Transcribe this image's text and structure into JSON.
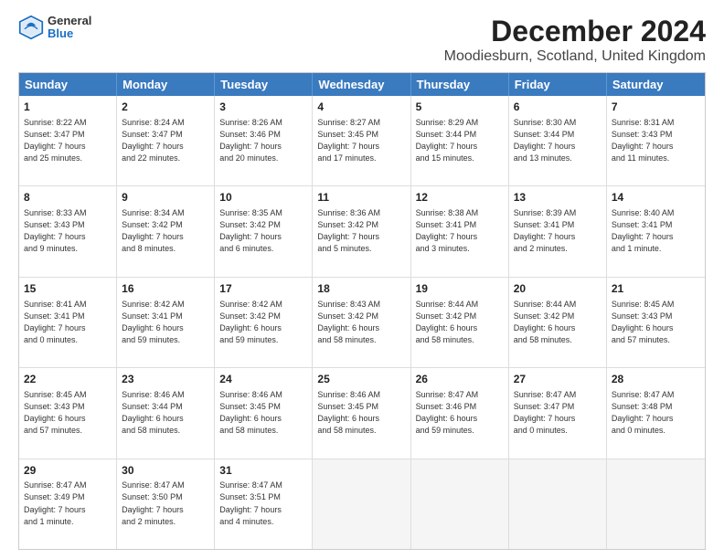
{
  "header": {
    "title": "December 2024",
    "subtitle": "Moodiesburn, Scotland, United Kingdom",
    "logo_general": "General",
    "logo_blue": "Blue"
  },
  "days": [
    "Sunday",
    "Monday",
    "Tuesday",
    "Wednesday",
    "Thursday",
    "Friday",
    "Saturday"
  ],
  "weeks": [
    [
      {
        "day": "1",
        "lines": [
          "Sunrise: 8:22 AM",
          "Sunset: 3:47 PM",
          "Daylight: 7 hours",
          "and 25 minutes."
        ]
      },
      {
        "day": "2",
        "lines": [
          "Sunrise: 8:24 AM",
          "Sunset: 3:47 PM",
          "Daylight: 7 hours",
          "and 22 minutes."
        ]
      },
      {
        "day": "3",
        "lines": [
          "Sunrise: 8:26 AM",
          "Sunset: 3:46 PM",
          "Daylight: 7 hours",
          "and 20 minutes."
        ]
      },
      {
        "day": "4",
        "lines": [
          "Sunrise: 8:27 AM",
          "Sunset: 3:45 PM",
          "Daylight: 7 hours",
          "and 17 minutes."
        ]
      },
      {
        "day": "5",
        "lines": [
          "Sunrise: 8:29 AM",
          "Sunset: 3:44 PM",
          "Daylight: 7 hours",
          "and 15 minutes."
        ]
      },
      {
        "day": "6",
        "lines": [
          "Sunrise: 8:30 AM",
          "Sunset: 3:44 PM",
          "Daylight: 7 hours",
          "and 13 minutes."
        ]
      },
      {
        "day": "7",
        "lines": [
          "Sunrise: 8:31 AM",
          "Sunset: 3:43 PM",
          "Daylight: 7 hours",
          "and 11 minutes."
        ]
      }
    ],
    [
      {
        "day": "8",
        "lines": [
          "Sunrise: 8:33 AM",
          "Sunset: 3:43 PM",
          "Daylight: 7 hours",
          "and 9 minutes."
        ]
      },
      {
        "day": "9",
        "lines": [
          "Sunrise: 8:34 AM",
          "Sunset: 3:42 PM",
          "Daylight: 7 hours",
          "and 8 minutes."
        ]
      },
      {
        "day": "10",
        "lines": [
          "Sunrise: 8:35 AM",
          "Sunset: 3:42 PM",
          "Daylight: 7 hours",
          "and 6 minutes."
        ]
      },
      {
        "day": "11",
        "lines": [
          "Sunrise: 8:36 AM",
          "Sunset: 3:42 PM",
          "Daylight: 7 hours",
          "and 5 minutes."
        ]
      },
      {
        "day": "12",
        "lines": [
          "Sunrise: 8:38 AM",
          "Sunset: 3:41 PM",
          "Daylight: 7 hours",
          "and 3 minutes."
        ]
      },
      {
        "day": "13",
        "lines": [
          "Sunrise: 8:39 AM",
          "Sunset: 3:41 PM",
          "Daylight: 7 hours",
          "and 2 minutes."
        ]
      },
      {
        "day": "14",
        "lines": [
          "Sunrise: 8:40 AM",
          "Sunset: 3:41 PM",
          "Daylight: 7 hours",
          "and 1 minute."
        ]
      }
    ],
    [
      {
        "day": "15",
        "lines": [
          "Sunrise: 8:41 AM",
          "Sunset: 3:41 PM",
          "Daylight: 7 hours",
          "and 0 minutes."
        ]
      },
      {
        "day": "16",
        "lines": [
          "Sunrise: 8:42 AM",
          "Sunset: 3:41 PM",
          "Daylight: 6 hours",
          "and 59 minutes."
        ]
      },
      {
        "day": "17",
        "lines": [
          "Sunrise: 8:42 AM",
          "Sunset: 3:42 PM",
          "Daylight: 6 hours",
          "and 59 minutes."
        ]
      },
      {
        "day": "18",
        "lines": [
          "Sunrise: 8:43 AM",
          "Sunset: 3:42 PM",
          "Daylight: 6 hours",
          "and 58 minutes."
        ]
      },
      {
        "day": "19",
        "lines": [
          "Sunrise: 8:44 AM",
          "Sunset: 3:42 PM",
          "Daylight: 6 hours",
          "and 58 minutes."
        ]
      },
      {
        "day": "20",
        "lines": [
          "Sunrise: 8:44 AM",
          "Sunset: 3:42 PM",
          "Daylight: 6 hours",
          "and 58 minutes."
        ]
      },
      {
        "day": "21",
        "lines": [
          "Sunrise: 8:45 AM",
          "Sunset: 3:43 PM",
          "Daylight: 6 hours",
          "and 57 minutes."
        ]
      }
    ],
    [
      {
        "day": "22",
        "lines": [
          "Sunrise: 8:45 AM",
          "Sunset: 3:43 PM",
          "Daylight: 6 hours",
          "and 57 minutes."
        ]
      },
      {
        "day": "23",
        "lines": [
          "Sunrise: 8:46 AM",
          "Sunset: 3:44 PM",
          "Daylight: 6 hours",
          "and 58 minutes."
        ]
      },
      {
        "day": "24",
        "lines": [
          "Sunrise: 8:46 AM",
          "Sunset: 3:45 PM",
          "Daylight: 6 hours",
          "and 58 minutes."
        ]
      },
      {
        "day": "25",
        "lines": [
          "Sunrise: 8:46 AM",
          "Sunset: 3:45 PM",
          "Daylight: 6 hours",
          "and 58 minutes."
        ]
      },
      {
        "day": "26",
        "lines": [
          "Sunrise: 8:47 AM",
          "Sunset: 3:46 PM",
          "Daylight: 6 hours",
          "and 59 minutes."
        ]
      },
      {
        "day": "27",
        "lines": [
          "Sunrise: 8:47 AM",
          "Sunset: 3:47 PM",
          "Daylight: 7 hours",
          "and 0 minutes."
        ]
      },
      {
        "day": "28",
        "lines": [
          "Sunrise: 8:47 AM",
          "Sunset: 3:48 PM",
          "Daylight: 7 hours",
          "and 0 minutes."
        ]
      }
    ],
    [
      {
        "day": "29",
        "lines": [
          "Sunrise: 8:47 AM",
          "Sunset: 3:49 PM",
          "Daylight: 7 hours",
          "and 1 minute."
        ]
      },
      {
        "day": "30",
        "lines": [
          "Sunrise: 8:47 AM",
          "Sunset: 3:50 PM",
          "Daylight: 7 hours",
          "and 2 minutes."
        ]
      },
      {
        "day": "31",
        "lines": [
          "Sunrise: 8:47 AM",
          "Sunset: 3:51 PM",
          "Daylight: 7 hours",
          "and 4 minutes."
        ]
      },
      null,
      null,
      null,
      null
    ]
  ]
}
